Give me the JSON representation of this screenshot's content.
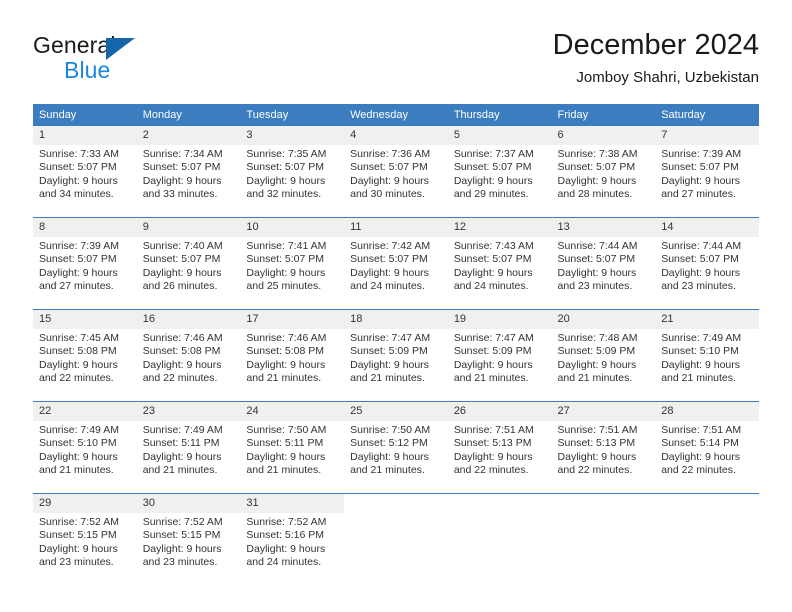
{
  "brand": {
    "name_top": "General",
    "name_bottom": "Blue",
    "accent_color": "#1a86d8",
    "triangle_color": "#1565a8"
  },
  "header": {
    "title": "December 2024",
    "subtitle": "Jomboy Shahri, Uzbekistan"
  },
  "theme": {
    "header_row_bg": "#3b7dbf",
    "header_row_text": "#ffffff",
    "daynum_bg": "#f0f0f0",
    "body_text": "#333333"
  },
  "weekdays": [
    "Sunday",
    "Monday",
    "Tuesday",
    "Wednesday",
    "Thursday",
    "Friday",
    "Saturday"
  ],
  "weeks": [
    [
      {
        "day": "1",
        "sunrise": "Sunrise: 7:33 AM",
        "sunset": "Sunset: 5:07 PM",
        "daylight1": "Daylight: 9 hours",
        "daylight2": "and 34 minutes."
      },
      {
        "day": "2",
        "sunrise": "Sunrise: 7:34 AM",
        "sunset": "Sunset: 5:07 PM",
        "daylight1": "Daylight: 9 hours",
        "daylight2": "and 33 minutes."
      },
      {
        "day": "3",
        "sunrise": "Sunrise: 7:35 AM",
        "sunset": "Sunset: 5:07 PM",
        "daylight1": "Daylight: 9 hours",
        "daylight2": "and 32 minutes."
      },
      {
        "day": "4",
        "sunrise": "Sunrise: 7:36 AM",
        "sunset": "Sunset: 5:07 PM",
        "daylight1": "Daylight: 9 hours",
        "daylight2": "and 30 minutes."
      },
      {
        "day": "5",
        "sunrise": "Sunrise: 7:37 AM",
        "sunset": "Sunset: 5:07 PM",
        "daylight1": "Daylight: 9 hours",
        "daylight2": "and 29 minutes."
      },
      {
        "day": "6",
        "sunrise": "Sunrise: 7:38 AM",
        "sunset": "Sunset: 5:07 PM",
        "daylight1": "Daylight: 9 hours",
        "daylight2": "and 28 minutes."
      },
      {
        "day": "7",
        "sunrise": "Sunrise: 7:39 AM",
        "sunset": "Sunset: 5:07 PM",
        "daylight1": "Daylight: 9 hours",
        "daylight2": "and 27 minutes."
      }
    ],
    [
      {
        "day": "8",
        "sunrise": "Sunrise: 7:39 AM",
        "sunset": "Sunset: 5:07 PM",
        "daylight1": "Daylight: 9 hours",
        "daylight2": "and 27 minutes."
      },
      {
        "day": "9",
        "sunrise": "Sunrise: 7:40 AM",
        "sunset": "Sunset: 5:07 PM",
        "daylight1": "Daylight: 9 hours",
        "daylight2": "and 26 minutes."
      },
      {
        "day": "10",
        "sunrise": "Sunrise: 7:41 AM",
        "sunset": "Sunset: 5:07 PM",
        "daylight1": "Daylight: 9 hours",
        "daylight2": "and 25 minutes."
      },
      {
        "day": "11",
        "sunrise": "Sunrise: 7:42 AM",
        "sunset": "Sunset: 5:07 PM",
        "daylight1": "Daylight: 9 hours",
        "daylight2": "and 24 minutes."
      },
      {
        "day": "12",
        "sunrise": "Sunrise: 7:43 AM",
        "sunset": "Sunset: 5:07 PM",
        "daylight1": "Daylight: 9 hours",
        "daylight2": "and 24 minutes."
      },
      {
        "day": "13",
        "sunrise": "Sunrise: 7:44 AM",
        "sunset": "Sunset: 5:07 PM",
        "daylight1": "Daylight: 9 hours",
        "daylight2": "and 23 minutes."
      },
      {
        "day": "14",
        "sunrise": "Sunrise: 7:44 AM",
        "sunset": "Sunset: 5:07 PM",
        "daylight1": "Daylight: 9 hours",
        "daylight2": "and 23 minutes."
      }
    ],
    [
      {
        "day": "15",
        "sunrise": "Sunrise: 7:45 AM",
        "sunset": "Sunset: 5:08 PM",
        "daylight1": "Daylight: 9 hours",
        "daylight2": "and 22 minutes."
      },
      {
        "day": "16",
        "sunrise": "Sunrise: 7:46 AM",
        "sunset": "Sunset: 5:08 PM",
        "daylight1": "Daylight: 9 hours",
        "daylight2": "and 22 minutes."
      },
      {
        "day": "17",
        "sunrise": "Sunrise: 7:46 AM",
        "sunset": "Sunset: 5:08 PM",
        "daylight1": "Daylight: 9 hours",
        "daylight2": "and 21 minutes."
      },
      {
        "day": "18",
        "sunrise": "Sunrise: 7:47 AM",
        "sunset": "Sunset: 5:09 PM",
        "daylight1": "Daylight: 9 hours",
        "daylight2": "and 21 minutes."
      },
      {
        "day": "19",
        "sunrise": "Sunrise: 7:47 AM",
        "sunset": "Sunset: 5:09 PM",
        "daylight1": "Daylight: 9 hours",
        "daylight2": "and 21 minutes."
      },
      {
        "day": "20",
        "sunrise": "Sunrise: 7:48 AM",
        "sunset": "Sunset: 5:09 PM",
        "daylight1": "Daylight: 9 hours",
        "daylight2": "and 21 minutes."
      },
      {
        "day": "21",
        "sunrise": "Sunrise: 7:49 AM",
        "sunset": "Sunset: 5:10 PM",
        "daylight1": "Daylight: 9 hours",
        "daylight2": "and 21 minutes."
      }
    ],
    [
      {
        "day": "22",
        "sunrise": "Sunrise: 7:49 AM",
        "sunset": "Sunset: 5:10 PM",
        "daylight1": "Daylight: 9 hours",
        "daylight2": "and 21 minutes."
      },
      {
        "day": "23",
        "sunrise": "Sunrise: 7:49 AM",
        "sunset": "Sunset: 5:11 PM",
        "daylight1": "Daylight: 9 hours",
        "daylight2": "and 21 minutes."
      },
      {
        "day": "24",
        "sunrise": "Sunrise: 7:50 AM",
        "sunset": "Sunset: 5:11 PM",
        "daylight1": "Daylight: 9 hours",
        "daylight2": "and 21 minutes."
      },
      {
        "day": "25",
        "sunrise": "Sunrise: 7:50 AM",
        "sunset": "Sunset: 5:12 PM",
        "daylight1": "Daylight: 9 hours",
        "daylight2": "and 21 minutes."
      },
      {
        "day": "26",
        "sunrise": "Sunrise: 7:51 AM",
        "sunset": "Sunset: 5:13 PM",
        "daylight1": "Daylight: 9 hours",
        "daylight2": "and 22 minutes."
      },
      {
        "day": "27",
        "sunrise": "Sunrise: 7:51 AM",
        "sunset": "Sunset: 5:13 PM",
        "daylight1": "Daylight: 9 hours",
        "daylight2": "and 22 minutes."
      },
      {
        "day": "28",
        "sunrise": "Sunrise: 7:51 AM",
        "sunset": "Sunset: 5:14 PM",
        "daylight1": "Daylight: 9 hours",
        "daylight2": "and 22 minutes."
      }
    ],
    [
      {
        "day": "29",
        "sunrise": "Sunrise: 7:52 AM",
        "sunset": "Sunset: 5:15 PM",
        "daylight1": "Daylight: 9 hours",
        "daylight2": "and 23 minutes."
      },
      {
        "day": "30",
        "sunrise": "Sunrise: 7:52 AM",
        "sunset": "Sunset: 5:15 PM",
        "daylight1": "Daylight: 9 hours",
        "daylight2": "and 23 minutes."
      },
      {
        "day": "31",
        "sunrise": "Sunrise: 7:52 AM",
        "sunset": "Sunset: 5:16 PM",
        "daylight1": "Daylight: 9 hours",
        "daylight2": "and 24 minutes."
      },
      {
        "day": "",
        "sunrise": "",
        "sunset": "",
        "daylight1": "",
        "daylight2": ""
      },
      {
        "day": "",
        "sunrise": "",
        "sunset": "",
        "daylight1": "",
        "daylight2": ""
      },
      {
        "day": "",
        "sunrise": "",
        "sunset": "",
        "daylight1": "",
        "daylight2": ""
      },
      {
        "day": "",
        "sunrise": "",
        "sunset": "",
        "daylight1": "",
        "daylight2": ""
      }
    ]
  ]
}
